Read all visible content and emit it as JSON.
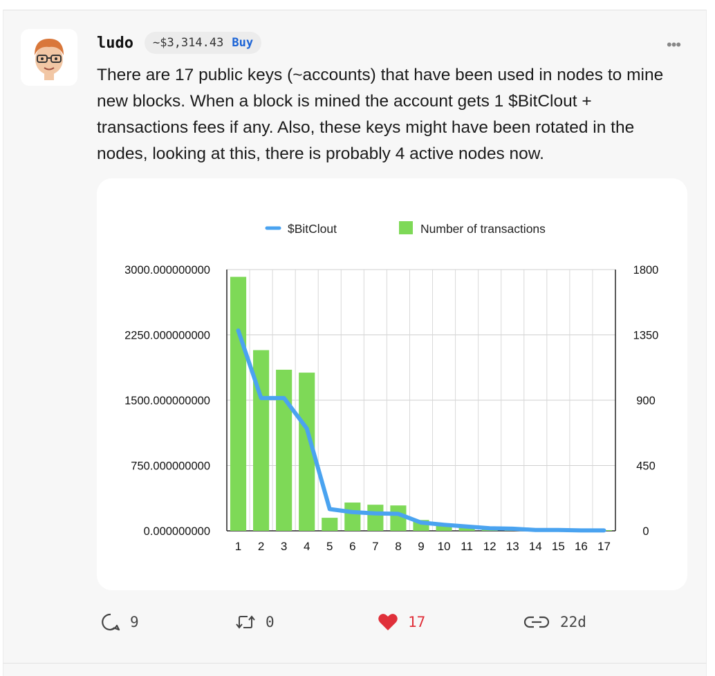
{
  "post": {
    "username": "ludo",
    "coin_price": "~$3,314.43",
    "buy_label": "Buy",
    "more_label": "•••",
    "text": "There are 17 public keys (~accounts) that have been used in nodes to mine new blocks. When a block is mined the account gets 1 $BitClout + transactions fees if any. Also, these keys might have been rotated in the nodes, looking at this, there is probably 4 active nodes now."
  },
  "actions": {
    "comments": "9",
    "reclouts": "0",
    "likes": "17",
    "time": "22d"
  },
  "colors": {
    "bar": "#7ed957",
    "line": "#4aa3f0",
    "like": "#e0303a"
  },
  "chart_data": {
    "type": "bar+line",
    "categories": [
      "1",
      "2",
      "3",
      "4",
      "5",
      "6",
      "7",
      "8",
      "9",
      "10",
      "11",
      "12",
      "13",
      "14",
      "15",
      "16",
      "17"
    ],
    "series": [
      {
        "name": "Number of transactions",
        "type": "bar",
        "axis": "right",
        "values": [
          1750,
          1245,
          1110,
          1090,
          90,
          195,
          180,
          175,
          75,
          45,
          30,
          15,
          15,
          5,
          5,
          5,
          5
        ]
      },
      {
        "name": "$BitClout",
        "type": "line",
        "axis": "left",
        "values": [
          2300,
          1525,
          1525,
          1175,
          250,
          215,
          200,
          195,
          95,
          70,
          50,
          30,
          25,
          10,
          10,
          5,
          5
        ]
      }
    ],
    "y_left": {
      "ticks": [
        "3000.000000000",
        "2250.000000000",
        "1500.000000000",
        "750.000000000",
        "0.000000000"
      ],
      "range": [
        0,
        3000
      ]
    },
    "y_right": {
      "ticks": [
        "1800",
        "1350",
        "900",
        "450",
        "0"
      ],
      "range": [
        0,
        1800
      ]
    },
    "legend": [
      "$BitClout",
      "Number of transactions"
    ],
    "legend_position": "top-center",
    "grid": true
  }
}
